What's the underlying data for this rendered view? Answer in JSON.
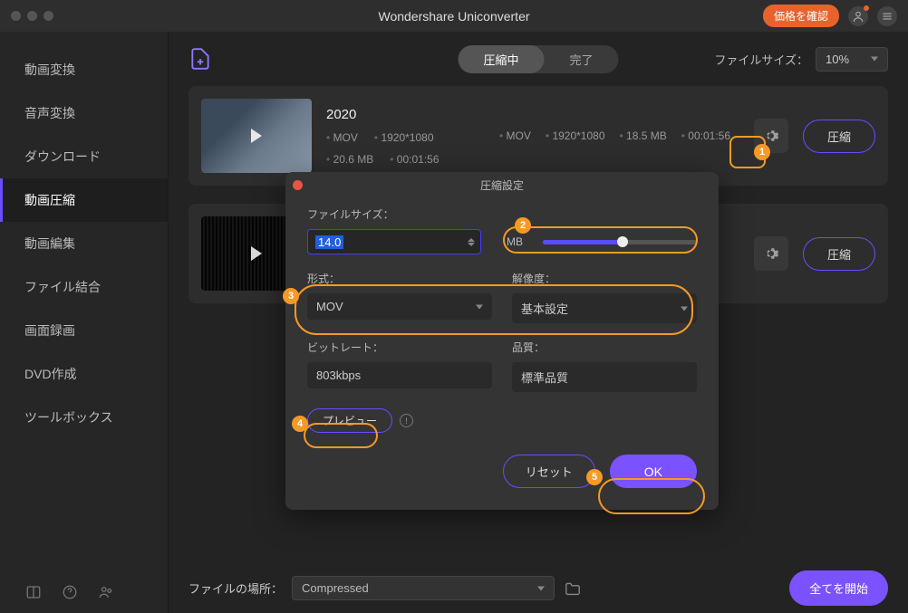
{
  "titlebar": {
    "title": "Wondershare Uniconverter",
    "price_btn": "価格を確認"
  },
  "sidebar": {
    "items": [
      {
        "label": "動画変換"
      },
      {
        "label": "音声変換"
      },
      {
        "label": "ダウンロード"
      },
      {
        "label": "動画圧縮"
      },
      {
        "label": "動画編集"
      },
      {
        "label": "ファイル結合"
      },
      {
        "label": "画面録画"
      },
      {
        "label": "DVD作成"
      },
      {
        "label": "ツールボックス"
      }
    ],
    "active_index": 3
  },
  "toolbar": {
    "tabs": {
      "compressing": "圧縮中",
      "done": "完了"
    },
    "filesize_label": "ファイルサイズ：",
    "filesize_value": "10%"
  },
  "files": [
    {
      "name": "2020",
      "in": {
        "format": "MOV",
        "res": "1920*1080",
        "size": "20.6 MB",
        "dur": "00:01:56"
      },
      "out": {
        "format": "MOV",
        "res": "1920*1080",
        "size": "18.5 MB",
        "dur": "00:01:56"
      },
      "compress_btn": "圧縮"
    },
    {
      "name": "",
      "compress_btn": "圧縮"
    }
  ],
  "dialog": {
    "title": "圧縮設定",
    "size_label": "ファイルサイズ：",
    "size_value": "14.0",
    "size_unit": "MB",
    "slider_pct": 52,
    "format_label": "形式：",
    "format_value": "MOV",
    "res_label": "解像度：",
    "res_value": "基本設定",
    "bitrate_label": "ビットレート：",
    "bitrate_value": "803kbps",
    "quality_label": "品質：",
    "quality_value": "標準品質",
    "preview_btn": "プレビュー",
    "reset_btn": "リセット",
    "ok_btn": "OK"
  },
  "footer": {
    "loc_label": "ファイルの場所：",
    "loc_value": "Compressed",
    "start_all": "全てを開始"
  },
  "annotations": {
    "1": "1",
    "2": "2",
    "3": "3",
    "4": "4",
    "5": "5"
  }
}
